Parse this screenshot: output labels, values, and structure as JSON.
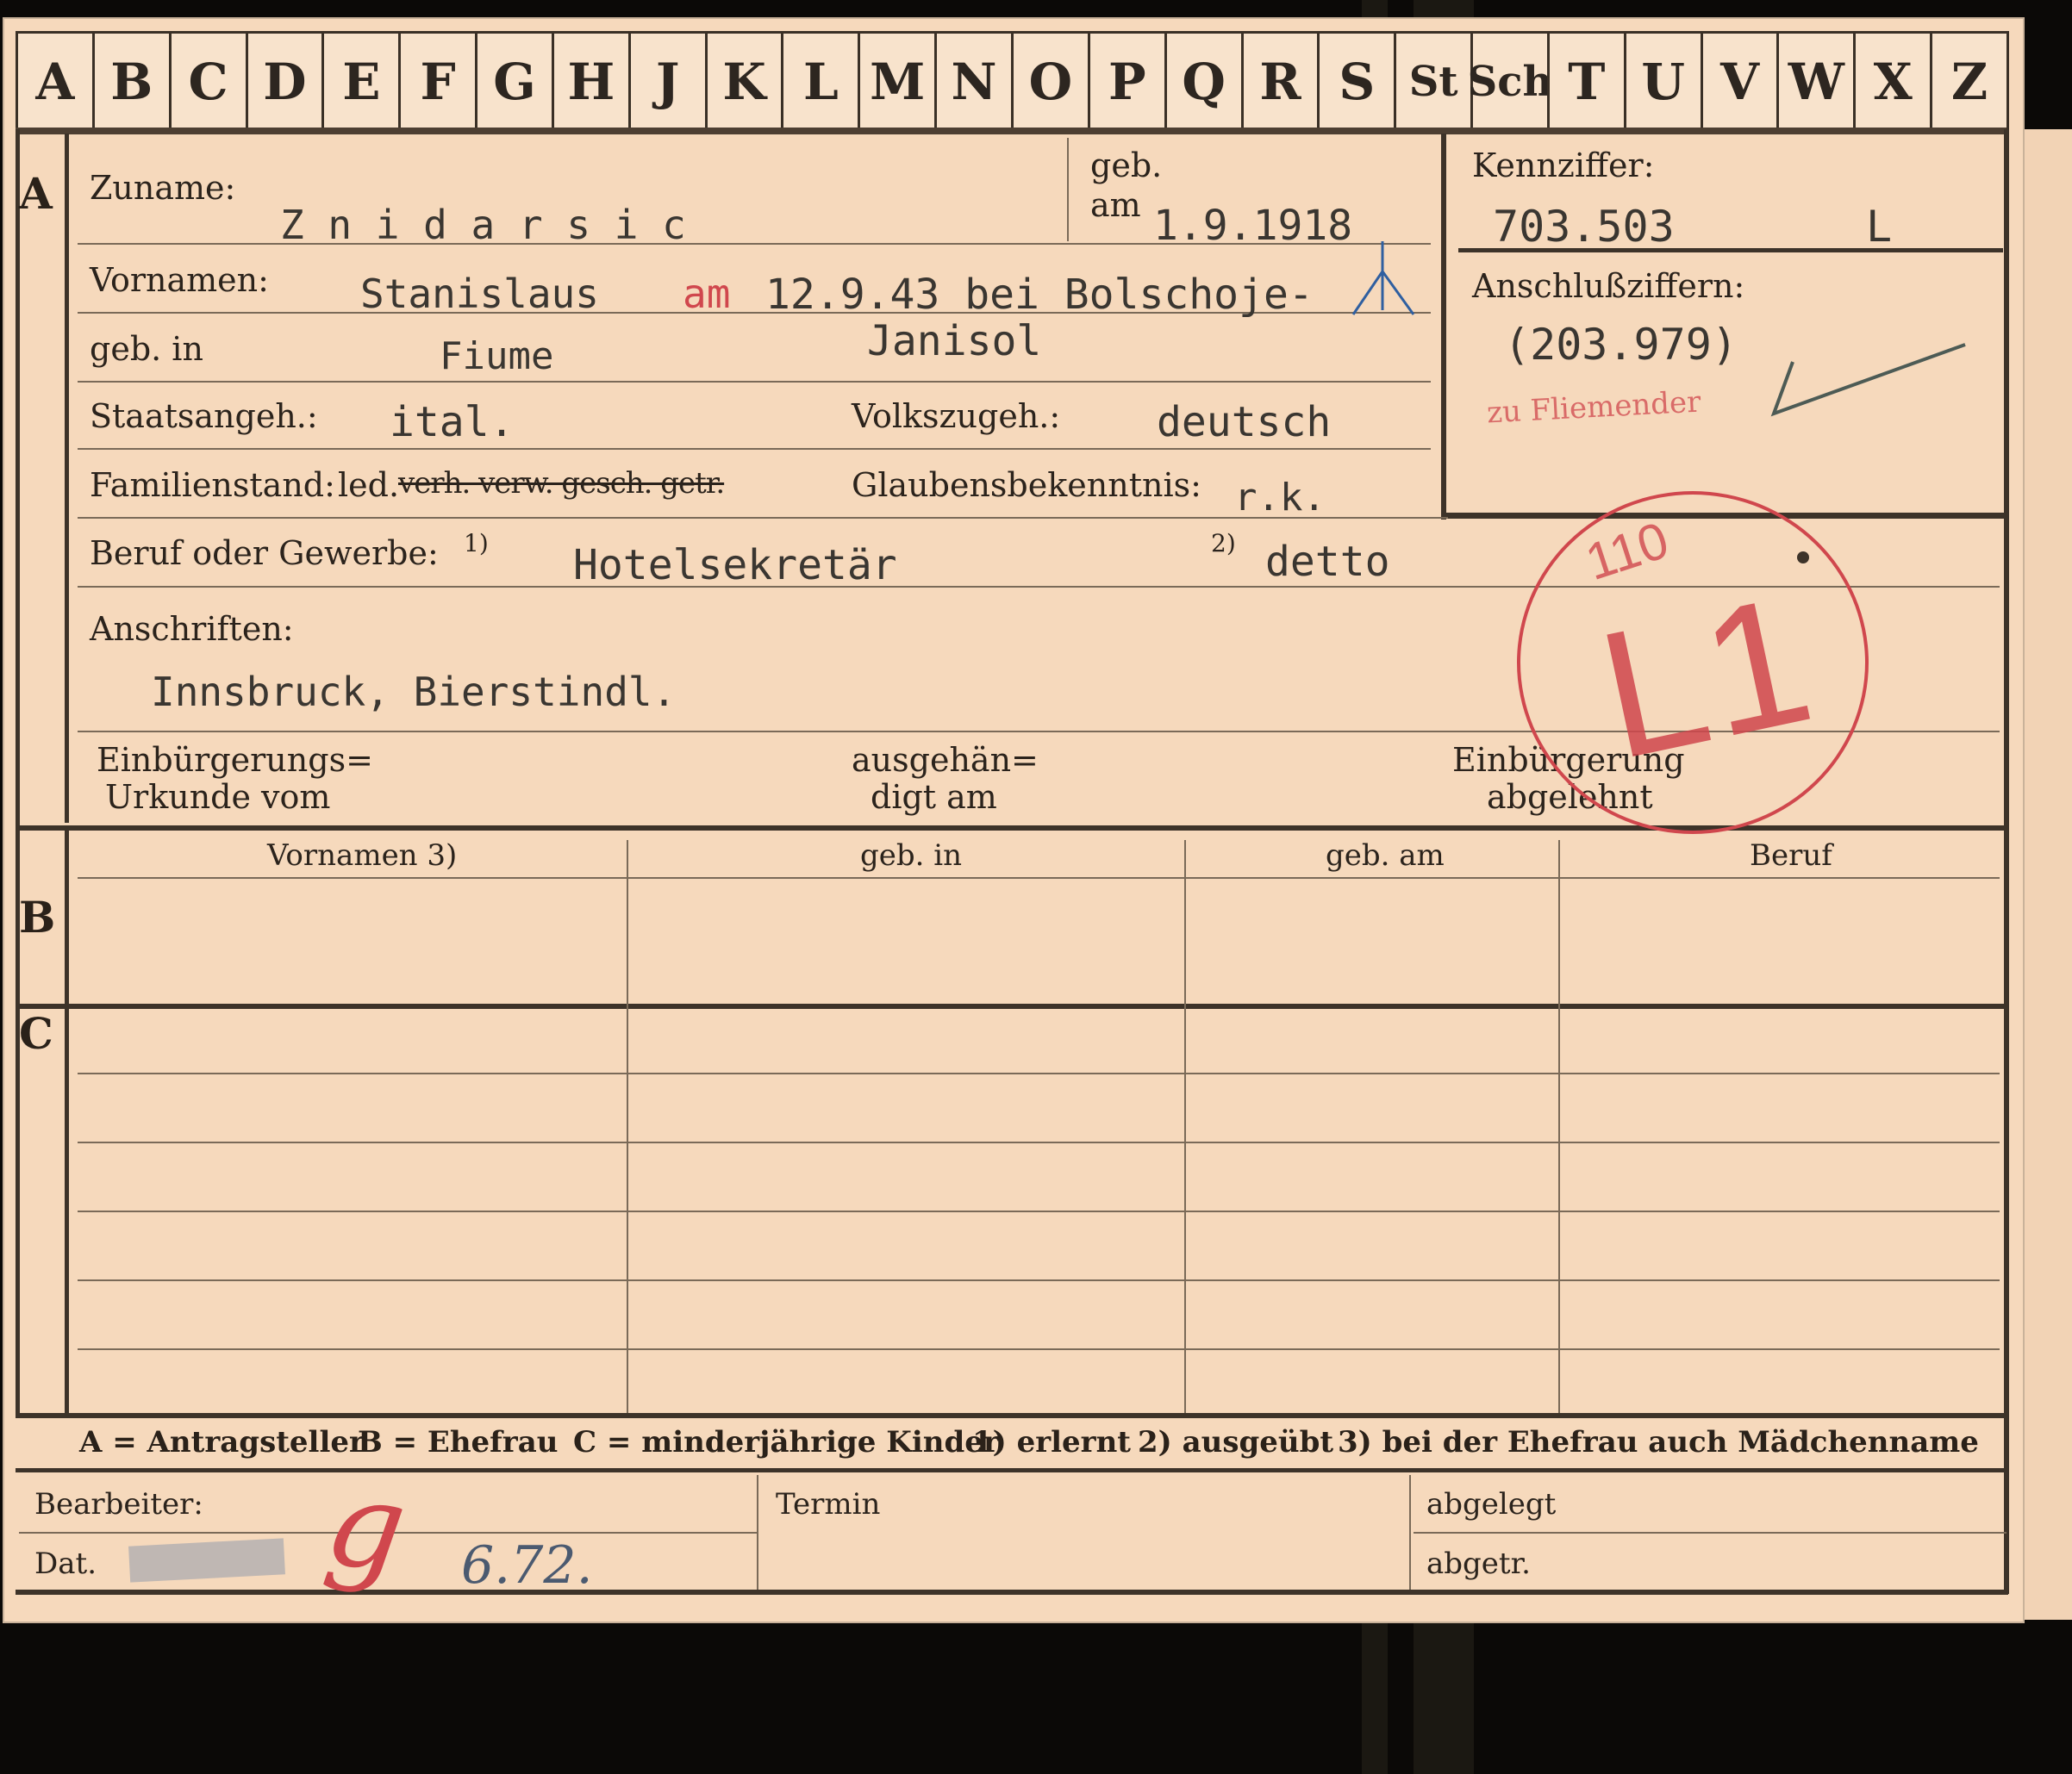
{
  "alphabet_tabs": [
    "A",
    "B",
    "C",
    "D",
    "E",
    "F",
    "G",
    "H",
    "J",
    "K",
    "L",
    "M",
    "N",
    "O",
    "P",
    "Q",
    "R",
    "S",
    "St",
    "Sch",
    "T",
    "U",
    "V",
    "W",
    "X",
    "Z"
  ],
  "sections": {
    "a": "A",
    "b": "B",
    "c": "C"
  },
  "applicant": {
    "surname_label": "Zuname:",
    "surname_value": "Z n i d a r s i c",
    "born_label_1": "geb.",
    "born_label_2": "am",
    "born_value": "1.9.1918",
    "firstnames_label": "Vornamen:",
    "firstnames_value": "Stanislaus",
    "death_note_red": "am",
    "death_note_text": "12.9.43 bei Bolschoje-",
    "death_note_line2": "Janisol",
    "birthplace_label": "geb. in",
    "birthplace_value": "Fiume",
    "citizenship_label": "Staatsangeh.:",
    "citizenship_value": "ital.",
    "ethnicity_label": "Volkszugeh.:",
    "ethnicity_value": "deutsch",
    "family_label": "Familienstand:",
    "family_options_active": "led.",
    "family_options_struck": "verh. verw. gesch. getr.",
    "religion_label": "Glaubensbekenntnis:",
    "religion_value": "r.k.",
    "profession_label": "Beruf oder Gewerbe:",
    "profession_note1": "1)",
    "profession_value": "Hotelsekretär",
    "profession_note2": "2)",
    "profession_value2": "detto",
    "address_label": "Anschriften:",
    "address_value": "Innsbruck, Bierstindl.",
    "naturalization_doc_label_1": "Einbürgerungs=",
    "naturalization_doc_label_2": "Urkunde vom",
    "handed_label_1": "ausgehän=",
    "handed_label_2": "digt am",
    "refused_label_1": "Einbürgerung",
    "refused_label_2": "abgelehnt"
  },
  "reference": {
    "id_label": "Kennziffer:",
    "id_value": "703.503",
    "id_suffix": "L",
    "linked_label": "Anschlußziffern:",
    "linked_value": "(203.979)",
    "linked_red_stamp": "zu Fliemender"
  },
  "stamp": {
    "small_text": "110",
    "main_text": "L1",
    "color": "#d0474d"
  },
  "spouse_table": {
    "headers": [
      "Vornamen 3)",
      "geb. in",
      "geb. am",
      "Beruf"
    ]
  },
  "legend": {
    "a": "A = Antragsteller",
    "b": "B = Ehefrau",
    "c": "C = minderjährige Kinder",
    "n1": "1) erlernt",
    "n2": "2) ausgeübt",
    "n3": "3) bei der Ehefrau auch Mädchenname"
  },
  "footer": {
    "editor_label": "Bearbeiter:",
    "date_label": "Dat.",
    "date_value": "6.72.",
    "editor_mark": "g",
    "deadline_label": "Termin",
    "filed_label": "abgelegt",
    "taken_label": "abgetr."
  },
  "colors": {
    "card": "#f6d9bc",
    "frame": "#3d3329",
    "stamp_red": "#d0474d",
    "pencil_blue": "#2f5fa0"
  }
}
